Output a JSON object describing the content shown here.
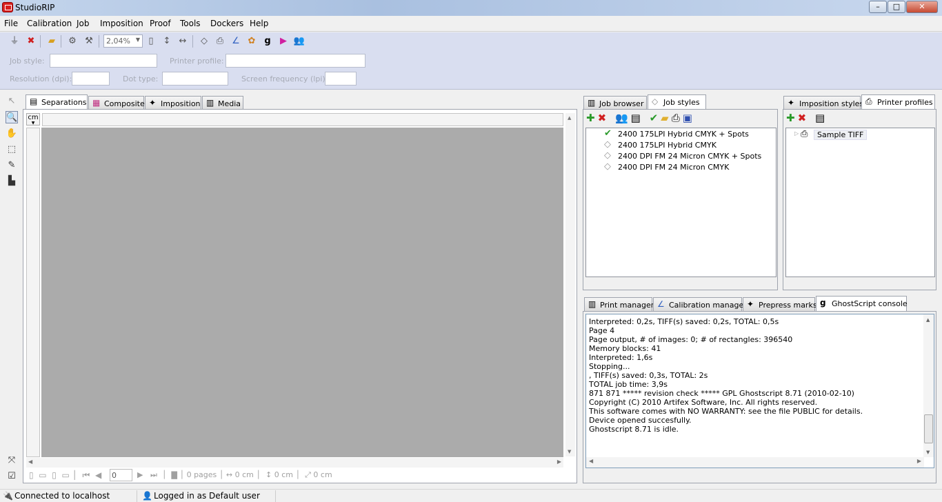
{
  "window": {
    "title": "StudioRIP",
    "controls": [
      "minimize",
      "maximize",
      "close"
    ]
  },
  "menu": [
    "File",
    "Calibration",
    "Job",
    "Imposition",
    "Proof",
    "Tools",
    "Dockers",
    "Help"
  ],
  "toolbar": {
    "zoom": "2,04%"
  },
  "form": {
    "job_style_label": "Job style:",
    "job_style_value": "",
    "printer_profile_label": "Printer profile:",
    "printer_profile_value": "",
    "resolution_label": "Resolution (dpi):",
    "resolution_value": "",
    "dot_type_label": "Dot type:",
    "dot_type_value": "",
    "screen_freq_label": "Screen frequency (lpi):",
    "screen_freq_value": ""
  },
  "center": {
    "tabs": [
      "Separations",
      "Composite",
      "Imposition",
      "Media"
    ],
    "active_tab": "Separations",
    "unit": "cm",
    "page_input": "0",
    "pages": "0 pages",
    "width": "0 cm",
    "height": "0 cm",
    "diag": "0 cm"
  },
  "job_panel": {
    "tabs": [
      "Job browser",
      "Job styles"
    ],
    "active_tab": "Job styles",
    "items": [
      {
        "label": "2400 175LPI Hybrid CMYK + Spots",
        "active": true
      },
      {
        "label": "2400 175LPI Hybrid CMYK",
        "active": false
      },
      {
        "label": "2400 DPI FM 24 Micron CMYK + Spots",
        "active": false
      },
      {
        "label": "2400 DPI FM 24 Micron CMYK",
        "active": false
      }
    ]
  },
  "printer_panel": {
    "tabs": [
      "Imposition styles",
      "Printer profiles"
    ],
    "active_tab": "Printer profiles",
    "items": [
      "Sample TIFF"
    ]
  },
  "console_panel": {
    "tabs": [
      "Print manager",
      "Calibration manager",
      "Prepress marks",
      "GhostScript console"
    ],
    "active_tab": "GhostScript console",
    "lines": [
      "Interpreted: 0,2s, TIFF(s) saved: 0,2s, TOTAL: 0,5s",
      "Page 4",
      "Page output, # of images: 0; # of rectangles: 396540",
      "Memory blocks: 41",
      "Interpreted: 1,6s",
      "Stopping...",
      ", TIFF(s) saved: 0,3s, TOTAL: 2s",
      "TOTAL job time: 3,9s",
      "871 871 ***** revision check ***** GPL Ghostscript 8.71 (2010-02-10)",
      "Copyright (C) 2010 Artifex Software, Inc.  All rights reserved.",
      "This software comes with NO WARRANTY: see the file PUBLIC for details.",
      "Device opened succesfully.",
      "Ghostscript 8.71 is idle."
    ]
  },
  "status": {
    "connection": "Connected to localhost",
    "user": "Logged in as Default user"
  }
}
